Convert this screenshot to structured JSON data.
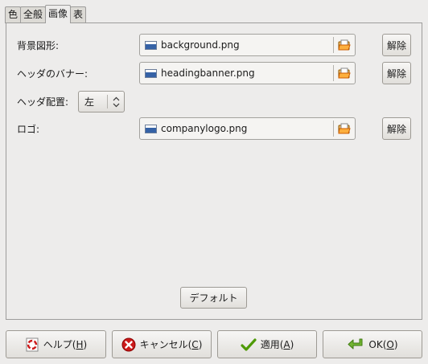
{
  "tabs": [
    {
      "label": "色",
      "active": false
    },
    {
      "label": "全般",
      "active": false
    },
    {
      "label": "画像",
      "active": true
    },
    {
      "label": "表",
      "active": false
    }
  ],
  "form": {
    "background_label": "背景図形:",
    "background_file": "background.png",
    "banner_label": "ヘッダのバナー:",
    "banner_file": "headingbanner.png",
    "align_label": "ヘッダ配置:",
    "align_value": "左",
    "logo_label": "ロゴ:",
    "logo_file": "companylogo.png",
    "release_label": "解除"
  },
  "default_button": "デフォルト",
  "buttons": {
    "help": {
      "text": "ヘルプ(",
      "mnemonic": "H",
      "end": ")"
    },
    "cancel": {
      "text": "キャンセル(",
      "mnemonic": "C",
      "end": ")"
    },
    "apply": {
      "text": "適用(",
      "mnemonic": "A",
      "end": ")"
    },
    "ok": {
      "text": "OK(",
      "mnemonic": "O",
      "end": ")"
    }
  },
  "icons": {
    "file": "image-file-icon",
    "open": "open-folder-icon",
    "help": "help-lifebuoy-icon",
    "cancel": "red-x-icon",
    "apply": "green-check-icon",
    "ok": "green-enter-arrow-icon"
  },
  "colors": {
    "window_bg": "#edeceb",
    "cancel_red": "#cc1a1a",
    "apply_green": "#4e9a06",
    "ok_green": "#73b532"
  }
}
